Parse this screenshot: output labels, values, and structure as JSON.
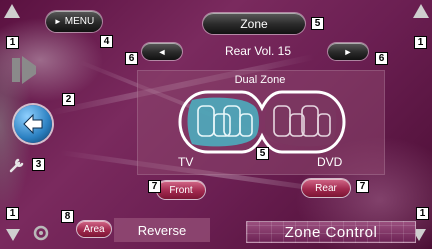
{
  "header": {
    "menu_label": "MENU",
    "zone_label": "Zone",
    "rear_volume_label": "Rear Vol. 15"
  },
  "zone_panel": {
    "title": "Dual Zone",
    "front_source": "TV",
    "rear_source": "DVD"
  },
  "buttons": {
    "front_label": "Front",
    "rear_label": "Rear",
    "area_label": "Area",
    "reverse_label": "Reverse",
    "zone_control_label": "Zone Control"
  },
  "callouts": {
    "c1a": "1",
    "c1b": "1",
    "c1c": "1",
    "c1d": "1",
    "c2": "2",
    "c3": "3",
    "c4": "4",
    "c5a": "5",
    "c5b": "5",
    "c6a": "6",
    "c6b": "6",
    "c7a": "7",
    "c7b": "7",
    "c8": "8"
  },
  "icons": {
    "left_arrow": "◄",
    "right_arrow": "►",
    "menu_arrow": "►"
  },
  "colors": {
    "accent": "#a2294f",
    "panel": "#7a3760",
    "seat": "#4fa7b8"
  }
}
